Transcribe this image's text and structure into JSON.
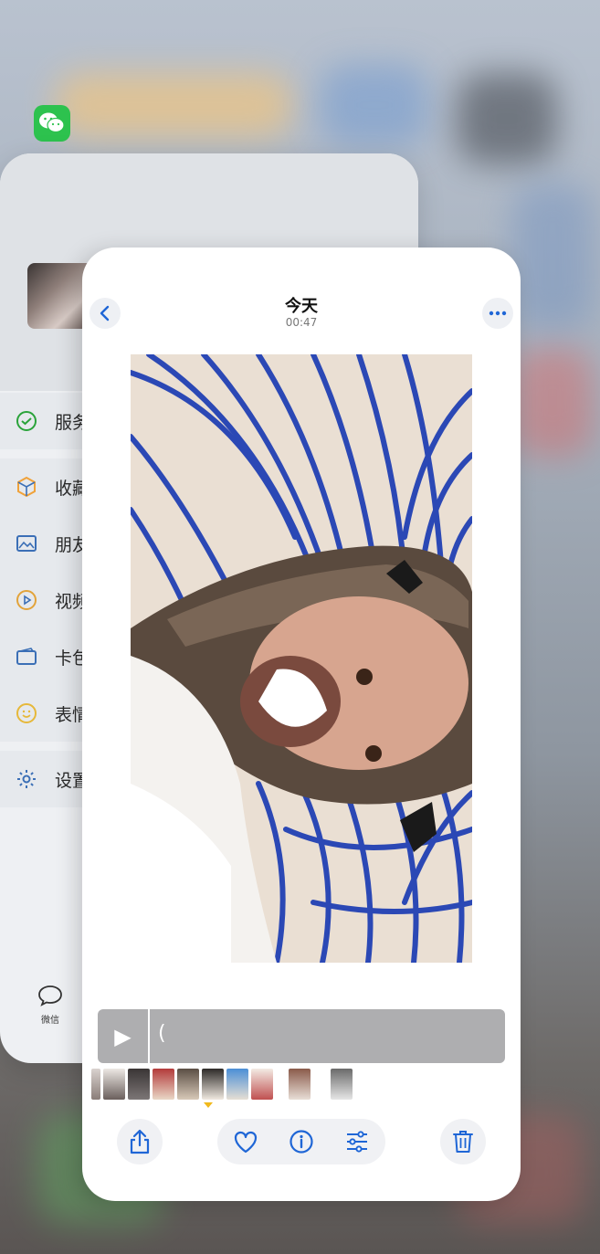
{
  "photos": {
    "header": {
      "title": "今天",
      "time": "00:47"
    },
    "player": {
      "play_symbol": "▶",
      "scrub_mark": "("
    }
  },
  "wechat": {
    "menu": [
      {
        "label": "服务",
        "icon": "wechat-pay-icon",
        "color": "#2aa33a"
      },
      {
        "label": "收藏",
        "icon": "cube-icon",
        "color": "#f0a23a"
      },
      {
        "label": "朋友",
        "icon": "image-icon",
        "color": "#3b6fb6"
      },
      {
        "label": "视频",
        "icon": "play-circle-icon",
        "color": "#e2a33a"
      },
      {
        "label": "卡包",
        "icon": "card-icon",
        "color": "#3b6fb6"
      },
      {
        "label": "表情",
        "icon": "smile-icon",
        "color": "#e6b83a"
      },
      {
        "label": "设置",
        "icon": "gear-icon",
        "color": "#3b6fb6"
      }
    ],
    "tab_label": "微信"
  },
  "colors": {
    "accent_blue": "#1f66d6",
    "wechat_green": "#2dc24e",
    "thumb_indicator": "#f1b91c"
  }
}
